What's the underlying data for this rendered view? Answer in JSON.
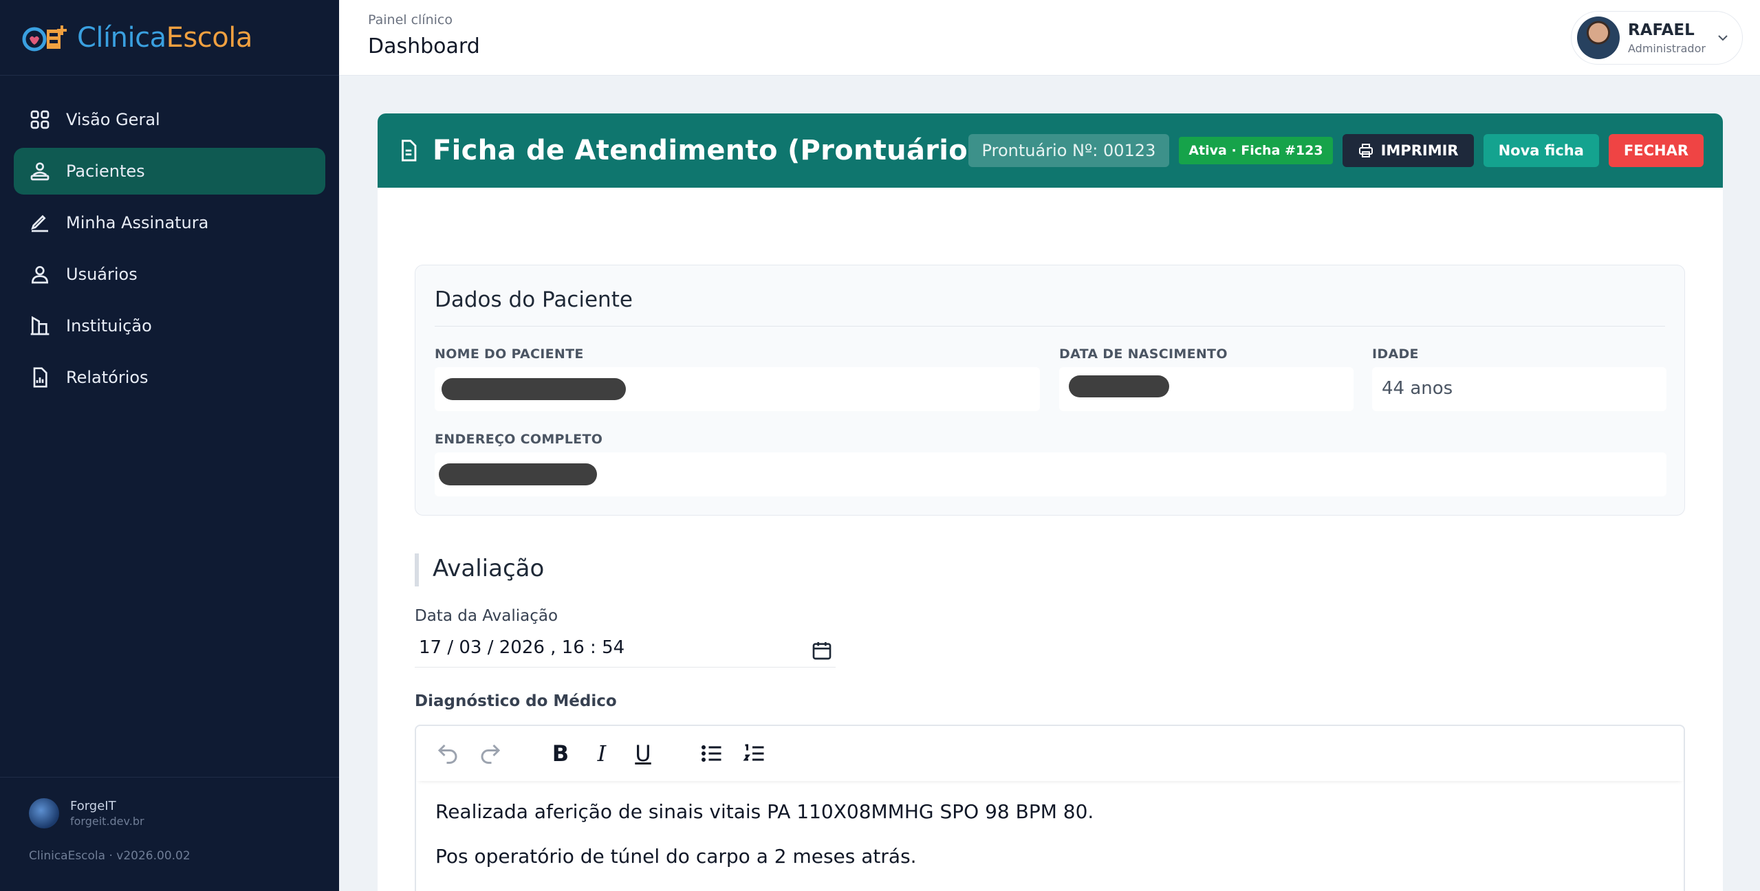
{
  "brand": {
    "part1": "Clínica",
    "part2": "Escola"
  },
  "sidebar": {
    "items": [
      {
        "label": "Visão Geral",
        "icon": "grid-icon"
      },
      {
        "label": "Pacientes",
        "icon": "patient-icon",
        "active": true
      },
      {
        "label": "Minha Assinatura",
        "icon": "pen-icon"
      },
      {
        "label": "Usuários",
        "icon": "users-icon"
      },
      {
        "label": "Instituição",
        "icon": "building-icon"
      },
      {
        "label": "Relatórios",
        "icon": "report-icon"
      }
    ],
    "footer": {
      "org": "ForgeIT",
      "url": "forgeit.dev.br",
      "version": "ClinicaEscola · v2026.00.02"
    }
  },
  "header": {
    "breadcrumb": "Painel clínico",
    "title": "Dashboard"
  },
  "user": {
    "name": "RAFAEL",
    "role": "Administrador"
  },
  "card": {
    "title": "Ficha de Atendimento (Prontuário)",
    "prontuario": "Prontuário Nº: 00123",
    "status": "Ativa · Ficha #123",
    "print_label": "IMPRIMIR",
    "new_label": "Nova ficha",
    "close_label": "FECHAR"
  },
  "patient": {
    "section_title": "Dados do Paciente",
    "name_label": "NOME DO PACIENTE",
    "birth_label": "DATA DE NASCIMENTO",
    "age_label": "IDADE",
    "age_value": "44 anos",
    "address_label": "ENDEREÇO COMPLETO"
  },
  "evaluation": {
    "section_title": "Avaliação",
    "date_label": "Data da Avaliação",
    "date_value": "17 / 03 / 2026 ,  16 : 54",
    "diagnosis_label": "Diagnóstico do Médico",
    "diagnosis_lines": [
      "Realizada aferição de sinais vitais PA 110X08MMHG SPO 98 BPM 80.",
      "Pos operatório de túnel do carpo a 2 meses atrás."
    ],
    "toolbar": {
      "bold": "B",
      "italic": "I",
      "underline": "U"
    }
  },
  "colors": {
    "sidebar_bg": "#0f1b33",
    "active_item": "#0f5a52",
    "header_teal": "#0f766e",
    "status_green": "#16a34a",
    "close_red": "#ef4444",
    "new_teal": "#14a38f"
  }
}
